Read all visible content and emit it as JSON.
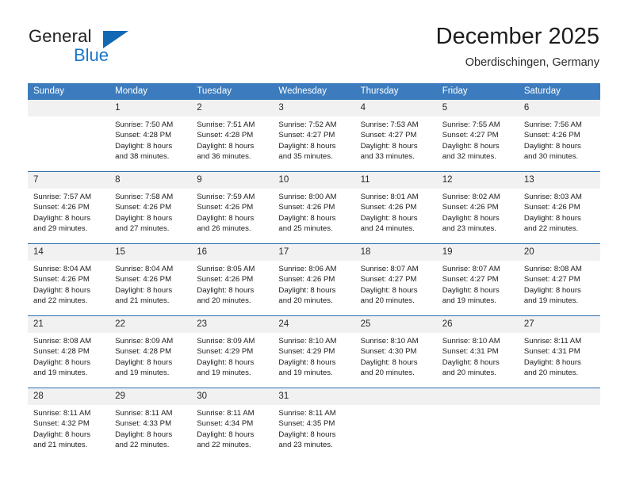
{
  "brand": {
    "name_top": "General",
    "name_bottom": "Blue"
  },
  "header": {
    "title": "December 2025",
    "location": "Oberdischingen, Germany"
  },
  "calendar": {
    "weekday_headers": [
      "Sunday",
      "Monday",
      "Tuesday",
      "Wednesday",
      "Thursday",
      "Friday",
      "Saturday"
    ],
    "accent_color": "#3c7cbe",
    "separator_color": "#2d6fb0",
    "daynum_band_color": "#f1f1f1",
    "weeks": [
      [
        {
          "day": "",
          "empty": true,
          "sunrise": "",
          "sunset": "",
          "daylight_line1": "",
          "daylight_line2": ""
        },
        {
          "day": "1",
          "sunrise": "Sunrise: 7:50 AM",
          "sunset": "Sunset: 4:28 PM",
          "daylight_line1": "Daylight: 8 hours",
          "daylight_line2": "and 38 minutes."
        },
        {
          "day": "2",
          "sunrise": "Sunrise: 7:51 AM",
          "sunset": "Sunset: 4:28 PM",
          "daylight_line1": "Daylight: 8 hours",
          "daylight_line2": "and 36 minutes."
        },
        {
          "day": "3",
          "sunrise": "Sunrise: 7:52 AM",
          "sunset": "Sunset: 4:27 PM",
          "daylight_line1": "Daylight: 8 hours",
          "daylight_line2": "and 35 minutes."
        },
        {
          "day": "4",
          "sunrise": "Sunrise: 7:53 AM",
          "sunset": "Sunset: 4:27 PM",
          "daylight_line1": "Daylight: 8 hours",
          "daylight_line2": "and 33 minutes."
        },
        {
          "day": "5",
          "sunrise": "Sunrise: 7:55 AM",
          "sunset": "Sunset: 4:27 PM",
          "daylight_line1": "Daylight: 8 hours",
          "daylight_line2": "and 32 minutes."
        },
        {
          "day": "6",
          "sunrise": "Sunrise: 7:56 AM",
          "sunset": "Sunset: 4:26 PM",
          "daylight_line1": "Daylight: 8 hours",
          "daylight_line2": "and 30 minutes."
        }
      ],
      [
        {
          "day": "7",
          "sunrise": "Sunrise: 7:57 AM",
          "sunset": "Sunset: 4:26 PM",
          "daylight_line1": "Daylight: 8 hours",
          "daylight_line2": "and 29 minutes."
        },
        {
          "day": "8",
          "sunrise": "Sunrise: 7:58 AM",
          "sunset": "Sunset: 4:26 PM",
          "daylight_line1": "Daylight: 8 hours",
          "daylight_line2": "and 27 minutes."
        },
        {
          "day": "9",
          "sunrise": "Sunrise: 7:59 AM",
          "sunset": "Sunset: 4:26 PM",
          "daylight_line1": "Daylight: 8 hours",
          "daylight_line2": "and 26 minutes."
        },
        {
          "day": "10",
          "sunrise": "Sunrise: 8:00 AM",
          "sunset": "Sunset: 4:26 PM",
          "daylight_line1": "Daylight: 8 hours",
          "daylight_line2": "and 25 minutes."
        },
        {
          "day": "11",
          "sunrise": "Sunrise: 8:01 AM",
          "sunset": "Sunset: 4:26 PM",
          "daylight_line1": "Daylight: 8 hours",
          "daylight_line2": "and 24 minutes."
        },
        {
          "day": "12",
          "sunrise": "Sunrise: 8:02 AM",
          "sunset": "Sunset: 4:26 PM",
          "daylight_line1": "Daylight: 8 hours",
          "daylight_line2": "and 23 minutes."
        },
        {
          "day": "13",
          "sunrise": "Sunrise: 8:03 AM",
          "sunset": "Sunset: 4:26 PM",
          "daylight_line1": "Daylight: 8 hours",
          "daylight_line2": "and 22 minutes."
        }
      ],
      [
        {
          "day": "14",
          "sunrise": "Sunrise: 8:04 AM",
          "sunset": "Sunset: 4:26 PM",
          "daylight_line1": "Daylight: 8 hours",
          "daylight_line2": "and 22 minutes."
        },
        {
          "day": "15",
          "sunrise": "Sunrise: 8:04 AM",
          "sunset": "Sunset: 4:26 PM",
          "daylight_line1": "Daylight: 8 hours",
          "daylight_line2": "and 21 minutes."
        },
        {
          "day": "16",
          "sunrise": "Sunrise: 8:05 AM",
          "sunset": "Sunset: 4:26 PM",
          "daylight_line1": "Daylight: 8 hours",
          "daylight_line2": "and 20 minutes."
        },
        {
          "day": "17",
          "sunrise": "Sunrise: 8:06 AM",
          "sunset": "Sunset: 4:26 PM",
          "daylight_line1": "Daylight: 8 hours",
          "daylight_line2": "and 20 minutes."
        },
        {
          "day": "18",
          "sunrise": "Sunrise: 8:07 AM",
          "sunset": "Sunset: 4:27 PM",
          "daylight_line1": "Daylight: 8 hours",
          "daylight_line2": "and 20 minutes."
        },
        {
          "day": "19",
          "sunrise": "Sunrise: 8:07 AM",
          "sunset": "Sunset: 4:27 PM",
          "daylight_line1": "Daylight: 8 hours",
          "daylight_line2": "and 19 minutes."
        },
        {
          "day": "20",
          "sunrise": "Sunrise: 8:08 AM",
          "sunset": "Sunset: 4:27 PM",
          "daylight_line1": "Daylight: 8 hours",
          "daylight_line2": "and 19 minutes."
        }
      ],
      [
        {
          "day": "21",
          "sunrise": "Sunrise: 8:08 AM",
          "sunset": "Sunset: 4:28 PM",
          "daylight_line1": "Daylight: 8 hours",
          "daylight_line2": "and 19 minutes."
        },
        {
          "day": "22",
          "sunrise": "Sunrise: 8:09 AM",
          "sunset": "Sunset: 4:28 PM",
          "daylight_line1": "Daylight: 8 hours",
          "daylight_line2": "and 19 minutes."
        },
        {
          "day": "23",
          "sunrise": "Sunrise: 8:09 AM",
          "sunset": "Sunset: 4:29 PM",
          "daylight_line1": "Daylight: 8 hours",
          "daylight_line2": "and 19 minutes."
        },
        {
          "day": "24",
          "sunrise": "Sunrise: 8:10 AM",
          "sunset": "Sunset: 4:29 PM",
          "daylight_line1": "Daylight: 8 hours",
          "daylight_line2": "and 19 minutes."
        },
        {
          "day": "25",
          "sunrise": "Sunrise: 8:10 AM",
          "sunset": "Sunset: 4:30 PM",
          "daylight_line1": "Daylight: 8 hours",
          "daylight_line2": "and 20 minutes."
        },
        {
          "day": "26",
          "sunrise": "Sunrise: 8:10 AM",
          "sunset": "Sunset: 4:31 PM",
          "daylight_line1": "Daylight: 8 hours",
          "daylight_line2": "and 20 minutes."
        },
        {
          "day": "27",
          "sunrise": "Sunrise: 8:11 AM",
          "sunset": "Sunset: 4:31 PM",
          "daylight_line1": "Daylight: 8 hours",
          "daylight_line2": "and 20 minutes."
        }
      ],
      [
        {
          "day": "28",
          "sunrise": "Sunrise: 8:11 AM",
          "sunset": "Sunset: 4:32 PM",
          "daylight_line1": "Daylight: 8 hours",
          "daylight_line2": "and 21 minutes."
        },
        {
          "day": "29",
          "sunrise": "Sunrise: 8:11 AM",
          "sunset": "Sunset: 4:33 PM",
          "daylight_line1": "Daylight: 8 hours",
          "daylight_line2": "and 22 minutes."
        },
        {
          "day": "30",
          "sunrise": "Sunrise: 8:11 AM",
          "sunset": "Sunset: 4:34 PM",
          "daylight_line1": "Daylight: 8 hours",
          "daylight_line2": "and 22 minutes."
        },
        {
          "day": "31",
          "sunrise": "Sunrise: 8:11 AM",
          "sunset": "Sunset: 4:35 PM",
          "daylight_line1": "Daylight: 8 hours",
          "daylight_line2": "and 23 minutes."
        },
        {
          "day": "",
          "empty": true,
          "sunrise": "",
          "sunset": "",
          "daylight_line1": "",
          "daylight_line2": ""
        },
        {
          "day": "",
          "empty": true,
          "sunrise": "",
          "sunset": "",
          "daylight_line1": "",
          "daylight_line2": ""
        },
        {
          "day": "",
          "empty": true,
          "sunrise": "",
          "sunset": "",
          "daylight_line1": "",
          "daylight_line2": ""
        }
      ]
    ]
  }
}
